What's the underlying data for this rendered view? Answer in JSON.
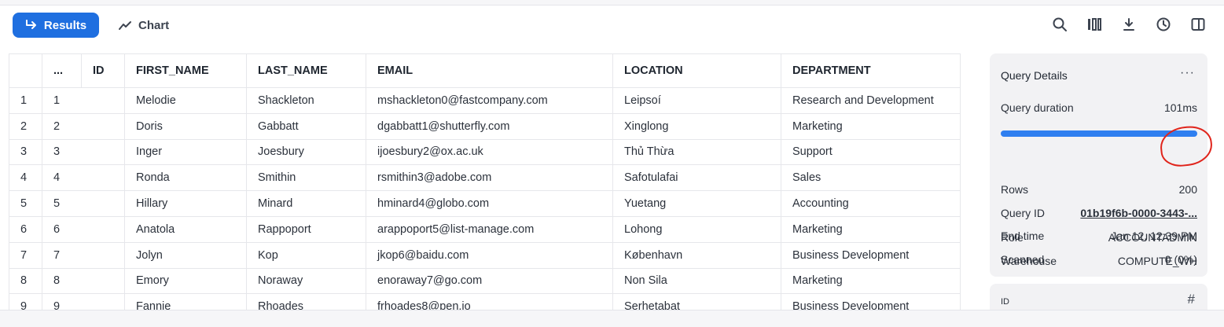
{
  "toolbar": {
    "results_label": "Results",
    "chart_label": "Chart",
    "icons": [
      "search-icon",
      "columns-icon",
      "download-icon",
      "history-icon",
      "panel-toggle-icon"
    ]
  },
  "table": {
    "columns": [
      "...",
      "ID",
      "FIRST_NAME",
      "LAST_NAME",
      "EMAIL",
      "LOCATION",
      "DEPARTMENT"
    ],
    "rows": [
      {
        "n": "1",
        "id": "1",
        "first": "Melodie",
        "last": "Shackleton",
        "email": "mshackleton0@fastcompany.com",
        "location": "Leipsoí",
        "dept": "Research and Development"
      },
      {
        "n": "2",
        "id": "2",
        "first": "Doris",
        "last": "Gabbatt",
        "email": "dgabbatt1@shutterfly.com",
        "location": "Xinglong",
        "dept": "Marketing"
      },
      {
        "n": "3",
        "id": "3",
        "first": "Inger",
        "last": "Joesbury",
        "email": "ijoesbury2@ox.ac.uk",
        "location": "Thủ Thừa",
        "dept": "Support"
      },
      {
        "n": "4",
        "id": "4",
        "first": "Ronda",
        "last": "Smithin",
        "email": "rsmithin3@adobe.com",
        "location": "Safotulafai",
        "dept": "Sales"
      },
      {
        "n": "5",
        "id": "5",
        "first": "Hillary",
        "last": "Minard",
        "email": "hminard4@globo.com",
        "location": "Yuetang",
        "dept": "Accounting"
      },
      {
        "n": "6",
        "id": "6",
        "first": "Anatola",
        "last": "Rappoport",
        "email": "arappoport5@list-manage.com",
        "location": "Lohong",
        "dept": "Marketing"
      },
      {
        "n": "7",
        "id": "7",
        "first": "Jolyn",
        "last": "Kop",
        "email": "jkop6@baidu.com",
        "location": "København",
        "dept": "Business Development"
      },
      {
        "n": "8",
        "id": "8",
        "first": "Emory",
        "last": "Noraway",
        "email": "enoraway7@go.com",
        "location": "Non Sila",
        "dept": "Marketing"
      },
      {
        "n": "9",
        "id": "9",
        "first": "Fannie",
        "last": "Rhoades",
        "email": "frhoades8@pen.io",
        "location": "Serhetabat",
        "dept": "Business Development"
      }
    ]
  },
  "details": {
    "title": "Query Details",
    "more": "···",
    "duration_label": "Query duration",
    "duration": "101ms",
    "duration_fill_pct": 100,
    "rows_label": "Rows",
    "rows": "200",
    "query_id_label": "Query ID",
    "query_id": "01b19f6b-0000-3443-...",
    "end_time_label": "End time",
    "end_time": "Jan 12, 12:39 PM",
    "scanned_label": "Scanned",
    "scanned": "0 (0%)",
    "role_label": "Role",
    "role": "ACCOUNTADMIN",
    "warehouse_label": "Warehouse",
    "warehouse": "COMPUTE_WH"
  },
  "column_panel": {
    "label": "ID",
    "type_icon": "hash-icon"
  },
  "annotation": {
    "color": "#e0241b"
  }
}
